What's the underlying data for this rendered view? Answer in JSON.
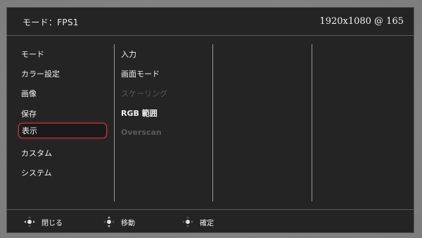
{
  "header": {
    "mode_label": "モード：FPS1",
    "resolution": "1920x1080 @ 165"
  },
  "main_menu": {
    "items": [
      {
        "label": "モード"
      },
      {
        "label": "カラー設定"
      },
      {
        "label": "画像"
      },
      {
        "label": "保存"
      },
      {
        "label": "表示",
        "selected": true
      },
      {
        "label": "カスタム"
      },
      {
        "label": "システム"
      }
    ]
  },
  "sub_menu": {
    "items": [
      {
        "label": "入力",
        "enabled": true
      },
      {
        "label": "画面モード",
        "enabled": true
      },
      {
        "label": "スケーリング",
        "enabled": false
      },
      {
        "label": "RGB 範囲",
        "enabled": true
      },
      {
        "label": "Overscan",
        "enabled": false
      }
    ]
  },
  "footer": {
    "close_label": "閉じる",
    "move_label": "移動",
    "confirm_label": "確定",
    "close_icon": "joystick-left-right-icon",
    "move_icon": "joystick-up-down-icon",
    "confirm_icon": "joystick-press-icon"
  },
  "colors": {
    "selection_border": "#c8324a",
    "background": "#242424",
    "text": "#f2f2f2",
    "disabled_text": "#5a5a5a"
  }
}
